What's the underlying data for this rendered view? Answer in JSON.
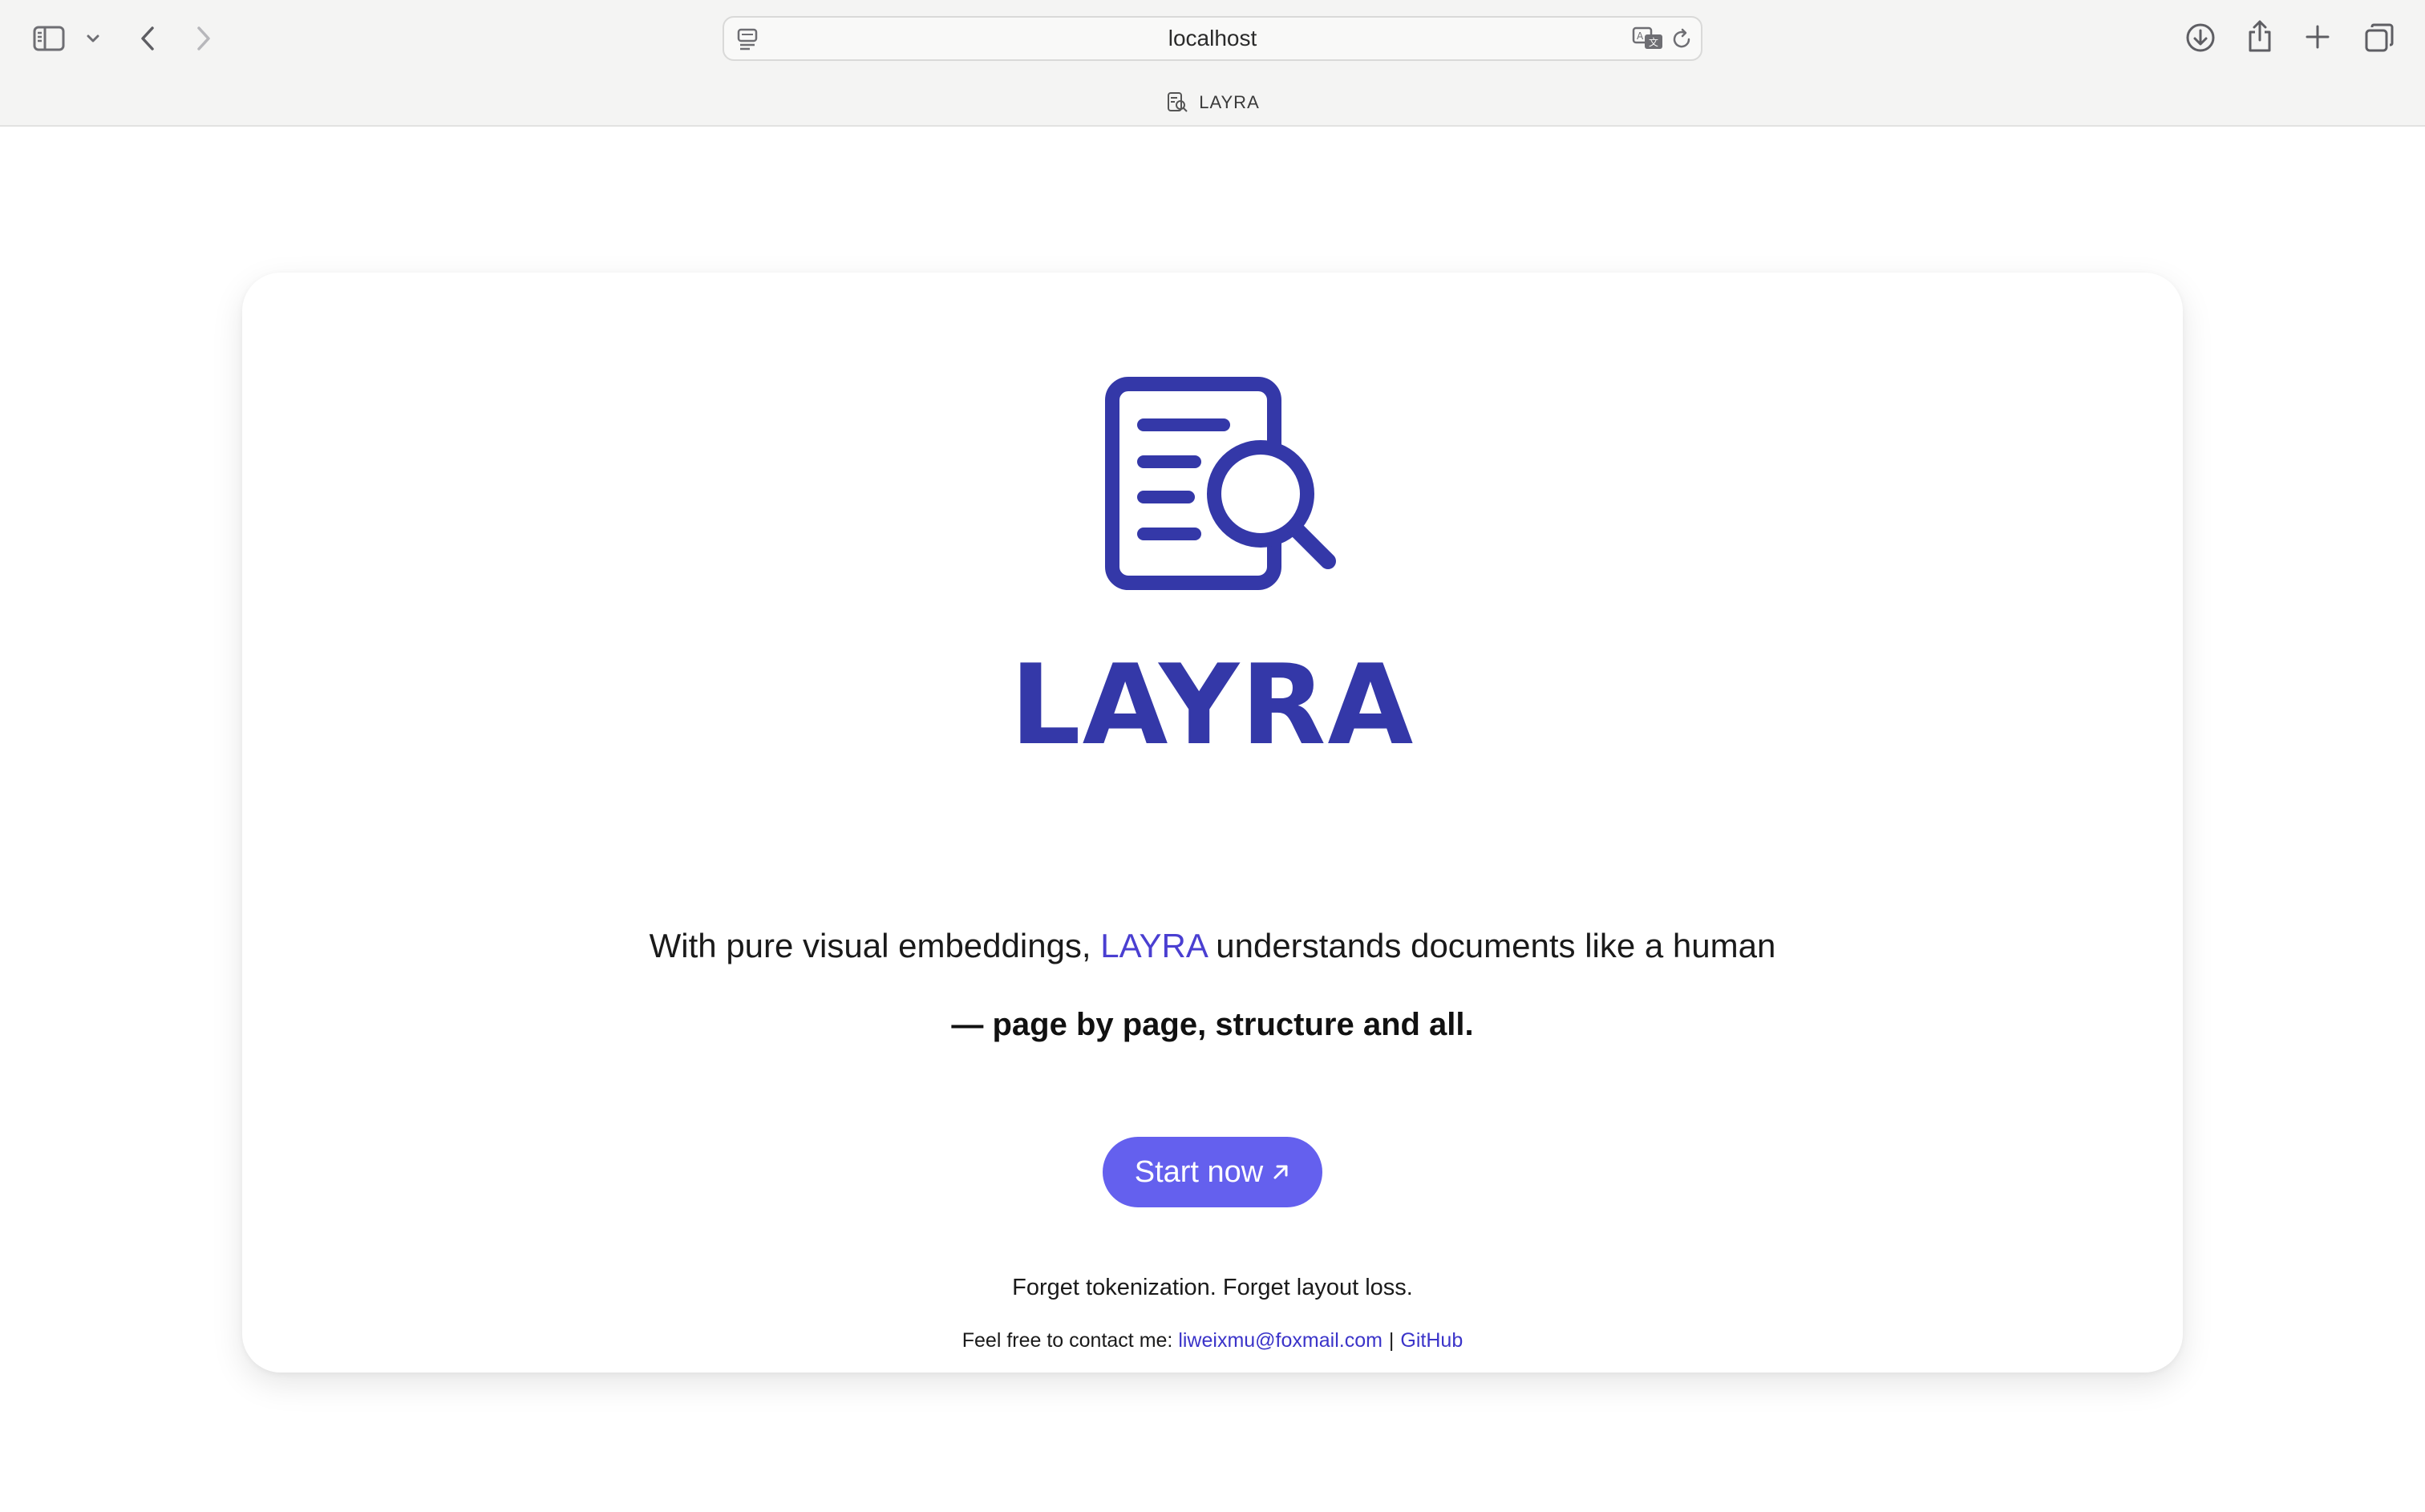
{
  "browser": {
    "url": "localhost",
    "tab_title": "LAYRA",
    "icons": [
      "sidebar-icon",
      "chevron-down-icon",
      "back-icon",
      "forward-icon",
      "page-icon",
      "translate-icon",
      "reload-icon",
      "download-icon",
      "share-icon",
      "new-tab-icon",
      "tab-overview-icon"
    ]
  },
  "hero": {
    "brand": "LAYRA",
    "tagline_prefix": "With pure visual embeddings, ",
    "tagline_highlight": "LAYRA",
    "tagline_suffix": " understands documents like a human",
    "tagline_bold": "— page by page, structure and all.",
    "cta_label": "Start now",
    "subline": "Forget tokenization. Forget layout loss.",
    "contact_prefix": "Feel free to contact me: ",
    "contact_email": "liweixmu@foxmail.com",
    "contact_separator": "|",
    "contact_github": "GitHub"
  },
  "colors": {
    "brand": "#3438a8",
    "accent": "#6460ee",
    "link": "#3b34c9"
  }
}
